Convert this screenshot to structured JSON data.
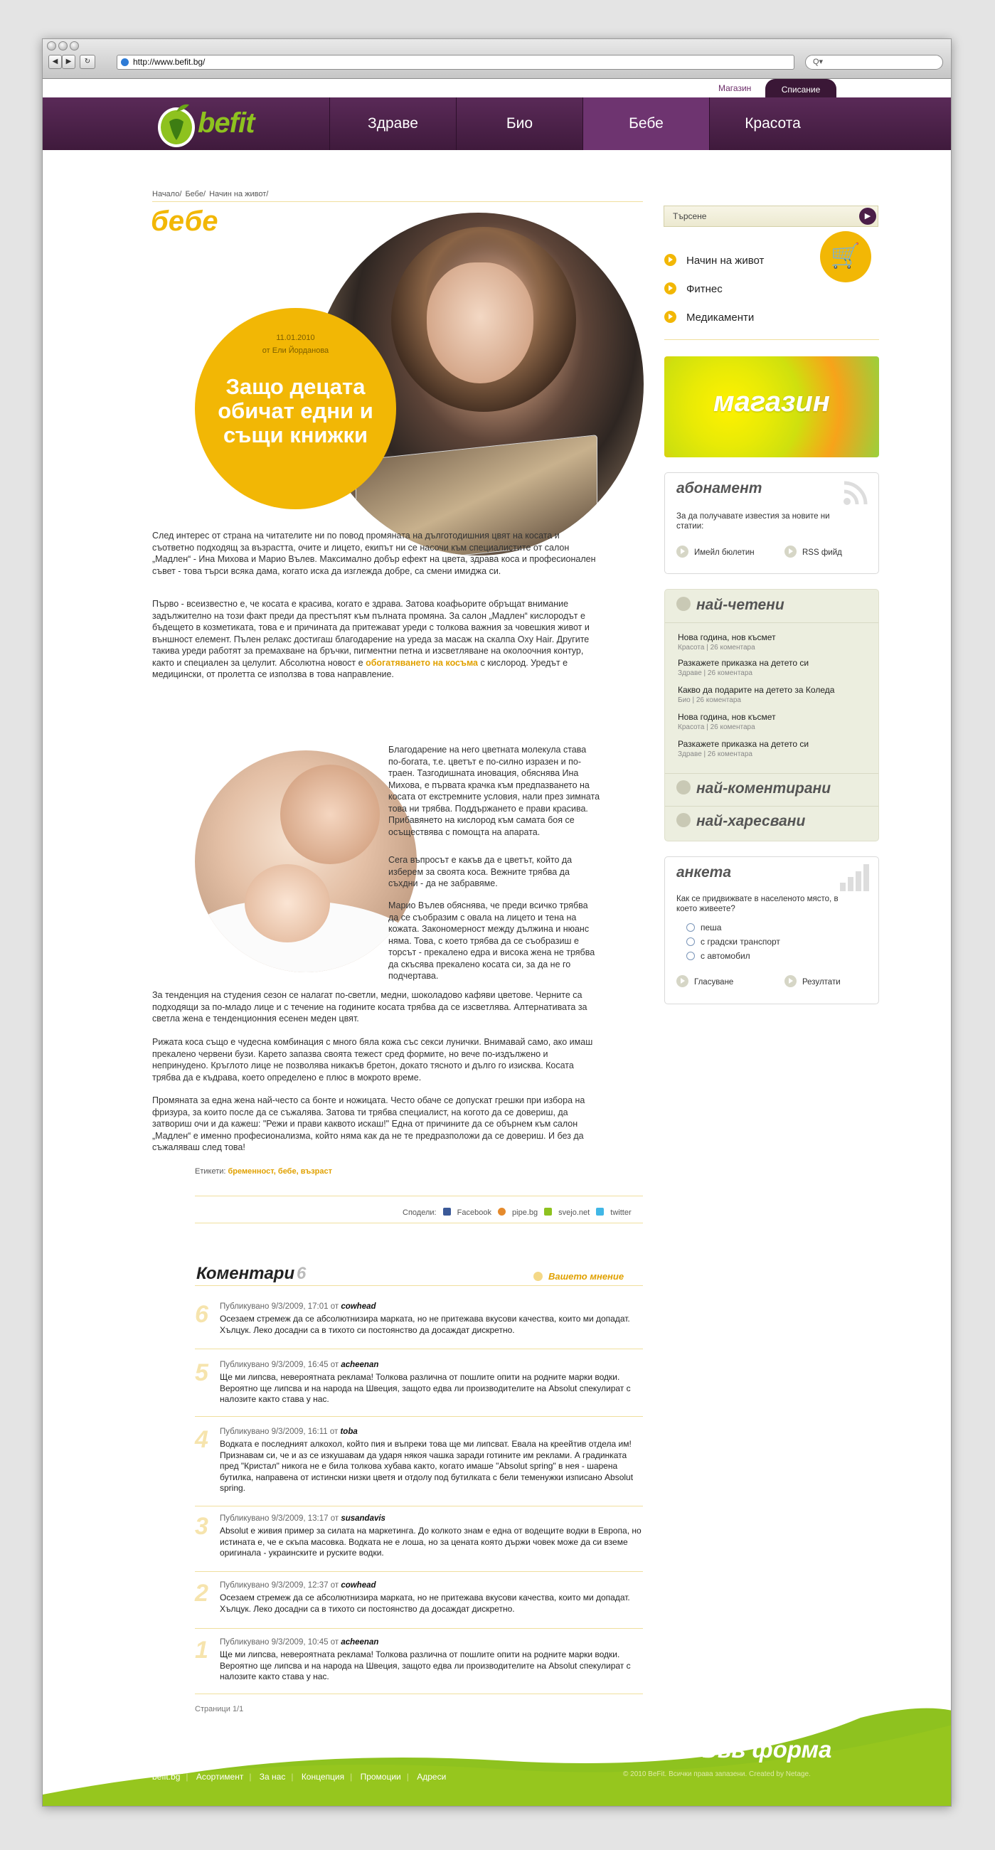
{
  "browser": {
    "url": "http://www.befit.bg/",
    "back": "◀",
    "forward": "▶",
    "reload": "↻",
    "search_placeholder": "Q▾"
  },
  "topbar": {
    "shop": "Магазин",
    "magazine": "Списание"
  },
  "logo": {
    "text": "befit"
  },
  "nav": [
    "Здраве",
    "Био",
    "Бебе",
    "Красота"
  ],
  "breadcrumb": [
    "Начало/",
    "Бебе/",
    "Начин на живот/"
  ],
  "category_title": "бебе",
  "article": {
    "date": "11.01.2010",
    "author": "от Ели Йорданова",
    "title": "Защо децата обичат едни и същи книжки",
    "p1": "След интерес от страна на читателите ни по повод промяната на дълготодишния цвят на косата и съответно подходящ за възрастта, очите и лицето, екипът ни се насочи към специалистите от салон „Мадлен“ - Ина Михова и Марио Вълев. Максимално добър ефект на цвета, здрава коса и професионален съвет - това търси всяка дама, когато иска да изглежда добре, са смени имиджа си.",
    "p2a": "Първо - всеизвестно е, че косата е красива, когато е здрава. Затова коафьорите обръщат внимание задължително на този факт преди да престъпят към пълната промяна. За салон „Мадлен“ кислородът е бъдещето в козметиката, това е и причината да притежават уреди с толкова важния за човешкия живот и външност елемент. Пълен релакс достигаш благодарение на уреда за масаж на скалпа Oxy Hair. Другите такива уреди работят за премахване на бръчки, пигментни петна и изсветляване на околоочния контур, както и специален за целулит. Абсолютна новост е ",
    "p2link": "обогатяването на косъма",
    "p2b": " с кислород. Уредът е медицински, от пролетта се използва в това направление.",
    "p3": "Благодарение на него цветната молекула става по-богата, т.е. цветът е по-силно изразен и по-траен. Тазгодишната иновация, обяснява Ина Михова, е първата крачка към предпазването на косата от екстремните условия, нали през зимната това ни трябва. Поддържането е прави красива. Прибавянето на кислород към самата боя се осъществява с помощта на апарата.",
    "p4": "Сега въпросът е какъв да е цветът, който да изберем за своята коса. Вежните трябва да съхдни - да не забравяме.",
    "p5": "Марио Вълев обяснява, че преди всичко трябва да се съобразим с овала на лицето и тена на кожата. Закономерност между дължина и нюанс няма. Това, с което трябва да се съобразиш е торсът - прекалено едра и висока жена не трябва да скъсява прекалено косата си, за да не го подчертава.",
    "p6": "За тенденция на студения сезон се налагат по-светли, медни, шоколадово кафяви цветове. Черните са подходящи за по-младо лице и с течение на годините косата трябва да се изсветлява. Алтернативата за светла жена е тенденционния есенен меден цвят.",
    "p7": "Рижата коса също е чудесна комбинация с много бяла кожа със секси лунички. Внимавай само, ако имаш прекалено червени бузи. Карето запазва своята тежест сред формите, но вече по-издължено и непринудено. Кръглото лице не позволява никакъв бретон, докато тясното и дълго го изисква. Косата трябва да е къдрава, което определено е плюс в мокрото време.",
    "p8": "Промяната за една жена най-често са бонте и ножицата. Често обаче се допускат грешки при избора на фризура, за които после да се съжалява. Затова ти трябва специалист, на когото да се довериш, да затвориш очи и да кажеш: \"Режи и прави каквото искаш!\" Една от причините да се обърнем към салон „Мадлен“ е именно професионализма, който няма как да не те предразположи да се довериш. И без да съжаляваш след това!",
    "tags_label": "Етикети:",
    "tags": "бременност, бебе, възраст"
  },
  "share": {
    "label": "Сподели:",
    "items": [
      "Facebook",
      "pipe.bg",
      "svejo.net",
      "twitter"
    ]
  },
  "comments": {
    "title": "Коментари",
    "count": "6",
    "your_opinion": "Вашето мнение",
    "items": [
      {
        "num": "6",
        "meta": "Публикувано 9/3/2009, 17:01 от ",
        "user": "cowhead",
        "text": "Осезаем стремеж да се абсолютнизира марката, но не притежава вкусови качества, които ми допадат. Хълцук. Леко досадни са в тихото си постоянство да досаждат дискретно."
      },
      {
        "num": "5",
        "meta": "Публикувано 9/3/2009, 16:45 от ",
        "user": "acheenan",
        "text": "Ще ми липсва, невероятната реклама! Толкова различна от пошлите опити на родните марки водки. Вероятно ще липсва и на народа на Швеция, защото едва ли производителите на Absolut спекулират с налозите както става у нас."
      },
      {
        "num": "4",
        "meta": "Публикувано 9/3/2009, 16:11 от ",
        "user": "toba",
        "text": "Водката е последният алкохол, който пия и въпреки това ще ми липсват. Евала на креейтив отдела им! Признавам си, че и аз се изкушавам да ударя някоя чашка заради готините им реклами. А градинката пред \"Кристал\" никога не е била толкова хубава както, когато имаше \"Absolut spring\" в нея - шарена бутилка, направена от истински низки цветя и отдолу под бутилката с бели теменужки изписано Absolut spring."
      },
      {
        "num": "3",
        "meta": "Публикувано 9/3/2009, 13:17 от ",
        "user": "susandavis",
        "text": "Absolut е живия пример за силата на маркетинга. До колкото знам е една от водещите водки в Европа, но истината е, че е скъпа масовка. Водката не е лоша, но за цената която държи човек може да си вземе оригинала - украинските и руските водки."
      },
      {
        "num": "2",
        "meta": "Публикувано 9/3/2009, 12:37 от ",
        "user": "cowhead",
        "text": "Осезаем стремеж да се абсолютнизира марката, но не притежава вкусови качества, които ми допадат. Хълцук. Леко досадни са в тихото си постоянство да досаждат дискретно."
      },
      {
        "num": "1",
        "meta": "Публикувано 9/3/2009, 10:45 от ",
        "user": "acheenan",
        "text": "Ще ми липсва, невероятната реклама! Толкова различна от пошлите опити на родните марки водки. Вероятно ще липсва и на народа на Швеция, защото едва ли производителите на Absolut спекулират с налозите както става у нас."
      }
    ],
    "pages": "Страници 1/1"
  },
  "sidebar": {
    "search_placeholder": "Търсене",
    "search_go": "▶",
    "category_icon": "🛒",
    "links": [
      "Начин на живот",
      "Фитнес",
      "Медикаменти"
    ],
    "shop_banner": "магазин",
    "subscribe": {
      "title": "абонамент",
      "text": "За да получавате известия за новите ни статии:",
      "email": "Имейл бюлетин",
      "rss": "RSS фийд"
    },
    "popular": {
      "most_read": "най-четени",
      "most_commented": "най-коментирани",
      "most_liked": "най-харесвани",
      "items": [
        {
          "title": "Нова година, нов късмет",
          "cat": "Красота",
          "comments": "26 коментара"
        },
        {
          "title": "Разкажете приказка на детето си",
          "cat": "Здраве",
          "comments": "26 коментара"
        },
        {
          "title": "Какво да подарите на детето за Коледа",
          "cat": "Био",
          "comments": "26 коментара"
        },
        {
          "title": "Нова година, нов късмет",
          "cat": "Красота",
          "comments": "26 коментара"
        },
        {
          "title": "Разкажете приказка на детето си",
          "cat": "Здраве",
          "comments": "26 коментара"
        }
      ]
    },
    "poll": {
      "title": "анкета",
      "question": "Как се придвижвате в населеното място, в което живеете?",
      "options": [
        "пеша",
        "с градски транспорт",
        "с автомобил"
      ],
      "vote": "Гласуване",
      "results": "Резултати"
    }
  },
  "footer": {
    "slogan": "живей във форма",
    "copyright": "© 2010 BeFit. Всички права запазени. Created by Netage.",
    "links": [
      "befit.bg",
      "Асортимент",
      "За нас",
      "Концепция",
      "Промоции",
      "Адреси"
    ]
  },
  "colors": {
    "brand_purple": "#4b1e48",
    "accent_yellow": "#f2b705",
    "green": "#8ec21f"
  }
}
